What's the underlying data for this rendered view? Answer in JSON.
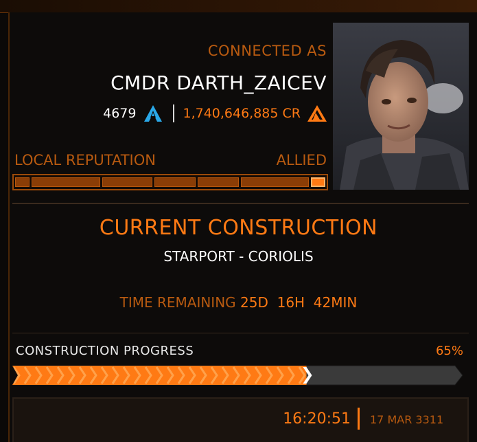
{
  "header": {
    "connected_as": "CONNECTED AS",
    "commander_name": "CMDR DARTH_ZAICEV",
    "rank_value": "4679",
    "rank_icon": "federation-rank-icon",
    "credits": "1,740,646,885 CR",
    "credits_icon": "credits-icon"
  },
  "reputation": {
    "label": "LOCAL REPUTATION",
    "status": "ALLIED",
    "level_fraction": 1.0
  },
  "construction": {
    "title": "CURRENT CONSTRUCTION",
    "subtitle": "STARPORT - CORIOLIS",
    "time_label": "TIME REMAINING",
    "time_value": "25D  16H  42MIN"
  },
  "progress": {
    "label": "CONSTRUCTION PROGRESS",
    "percent_text": "65%",
    "fraction": 0.65
  },
  "footer": {
    "time": "16:20:51",
    "date": "17 MAR 3311"
  },
  "colors": {
    "accent": "#ff7a14",
    "accent_dim": "#b85a10",
    "background": "#0d0b0a"
  }
}
